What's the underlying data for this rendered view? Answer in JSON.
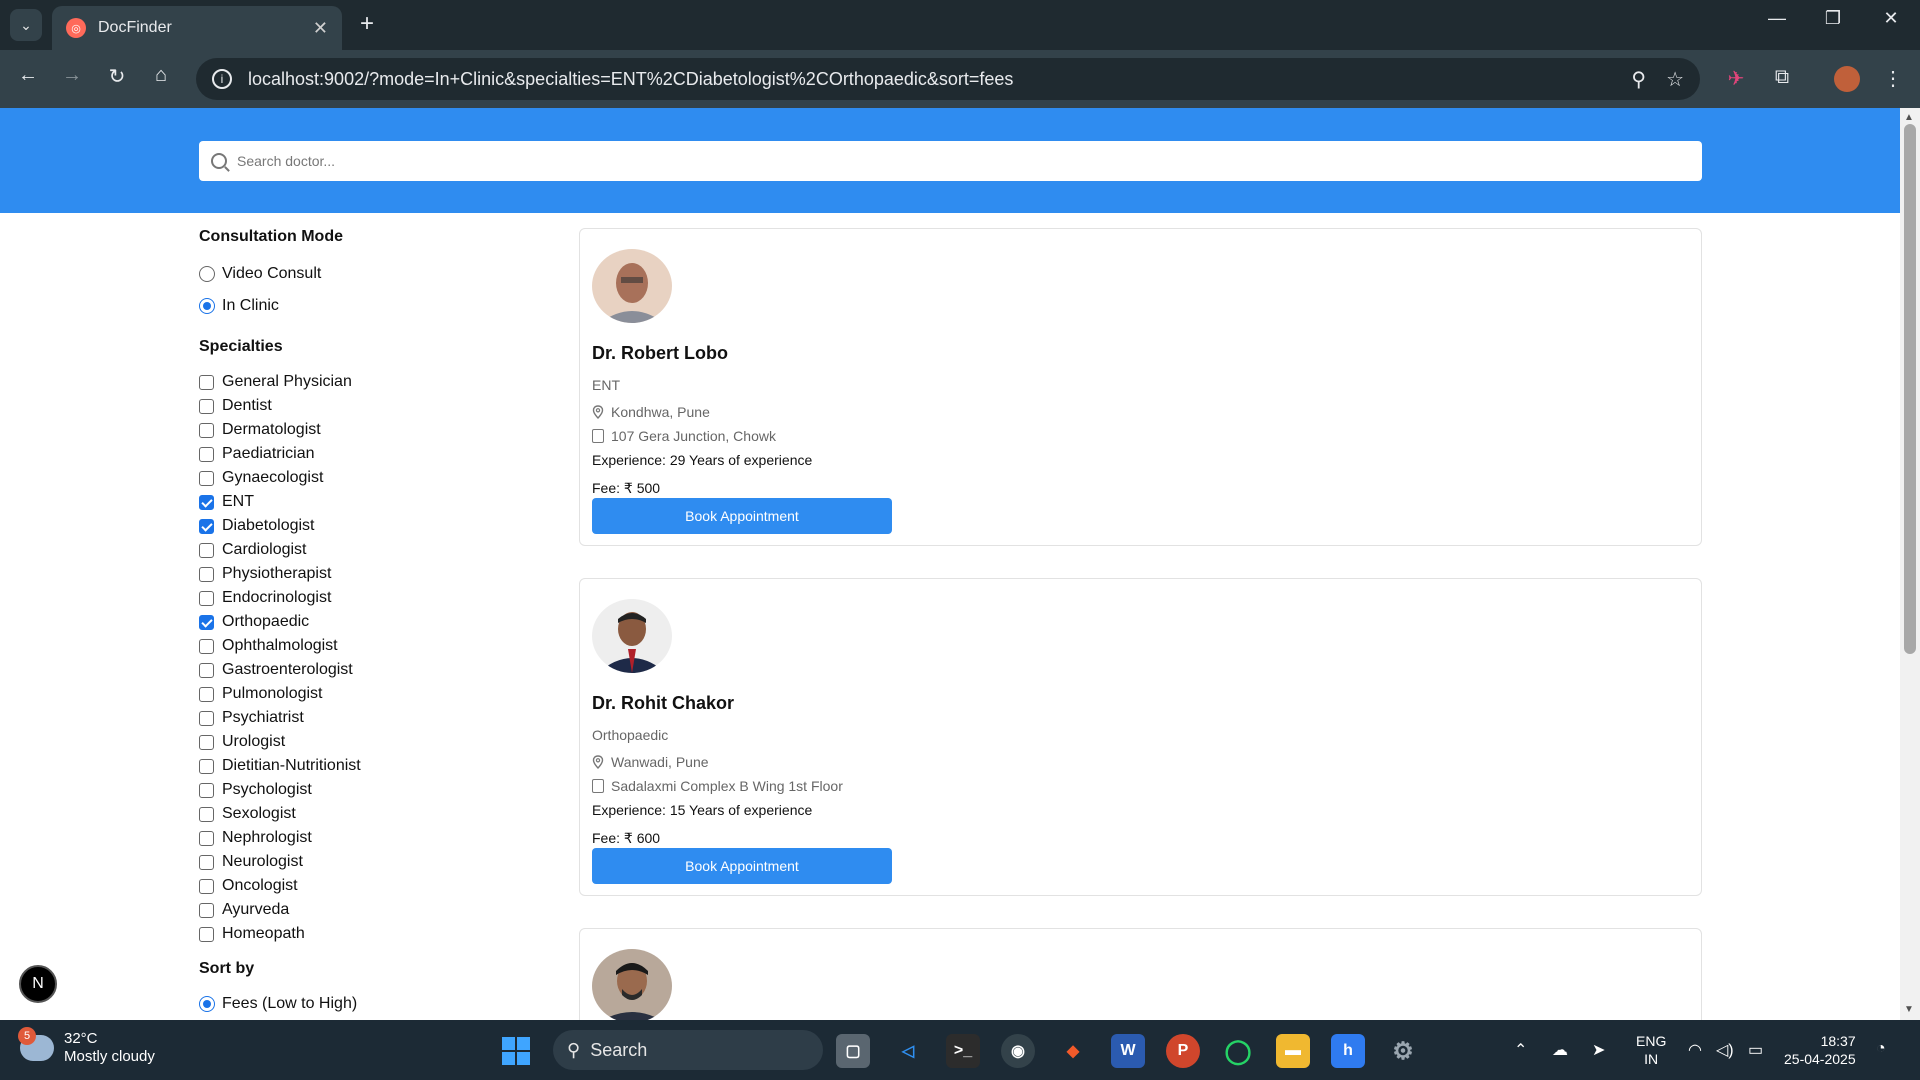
{
  "browser": {
    "tab_title": "DocFinder",
    "url": "localhost:9002/?mode=In+Clinic&specialties=ENT%2CDiabetologist%2COrthopaedic&sort=fees"
  },
  "search": {
    "placeholder": "Search doctor..."
  },
  "filters": {
    "mode_heading": "Consultation Mode",
    "modes": [
      {
        "label": "Video Consult",
        "selected": false
      },
      {
        "label": "In Clinic",
        "selected": true
      }
    ],
    "specialties_heading": "Specialties",
    "specialties": [
      {
        "label": "General Physician",
        "checked": false
      },
      {
        "label": "Dentist",
        "checked": false
      },
      {
        "label": "Dermatologist",
        "checked": false
      },
      {
        "label": "Paediatrician",
        "checked": false
      },
      {
        "label": "Gynaecologist",
        "checked": false
      },
      {
        "label": "ENT",
        "checked": true
      },
      {
        "label": "Diabetologist",
        "checked": true
      },
      {
        "label": "Cardiologist",
        "checked": false
      },
      {
        "label": "Physiotherapist",
        "checked": false
      },
      {
        "label": "Endocrinologist",
        "checked": false
      },
      {
        "label": "Orthopaedic",
        "checked": true
      },
      {
        "label": "Ophthalmologist",
        "checked": false
      },
      {
        "label": "Gastroenterologist",
        "checked": false
      },
      {
        "label": "Pulmonologist",
        "checked": false
      },
      {
        "label": "Psychiatrist",
        "checked": false
      },
      {
        "label": "Urologist",
        "checked": false
      },
      {
        "label": "Dietitian-Nutritionist",
        "checked": false
      },
      {
        "label": "Psychologist",
        "checked": false
      },
      {
        "label": "Sexologist",
        "checked": false
      },
      {
        "label": "Nephrologist",
        "checked": false
      },
      {
        "label": "Neurologist",
        "checked": false
      },
      {
        "label": "Oncologist",
        "checked": false
      },
      {
        "label": "Ayurveda",
        "checked": false
      },
      {
        "label": "Homeopath",
        "checked": false
      }
    ],
    "sort_heading": "Sort by",
    "sort_options": [
      {
        "label": "Fees (Low to High)",
        "selected": true
      }
    ]
  },
  "doctors": [
    {
      "name": "Dr. Robert Lobo",
      "specialty": "ENT",
      "locality": "Kondhwa, Pune",
      "clinic": "107 Gera Junction, Chowk",
      "experience": "Experience: 29 Years of experience",
      "fee": "Fee: ₹ 500",
      "button": "Book Appointment"
    },
    {
      "name": "Dr. Rohit Chakor",
      "specialty": "Orthopaedic",
      "locality": "Wanwadi, Pune",
      "clinic": "Sadalaxmi Complex B Wing 1st Floor",
      "experience": "Experience: 15 Years of experience",
      "fee": "Fee: ₹ 600",
      "button": "Book Appointment"
    }
  ],
  "nextjs_badge": "N",
  "taskbar": {
    "weather_temp": "32°C",
    "weather_desc": "Mostly cloudy",
    "weather_badge": "5",
    "search_label": "Search",
    "lang_top": "ENG",
    "lang_bottom": "IN",
    "time": "18:37",
    "date": "25-04-2025"
  },
  "colors": {
    "brand_blue": "#2f8cf0",
    "checked_blue": "#1a73e8"
  }
}
